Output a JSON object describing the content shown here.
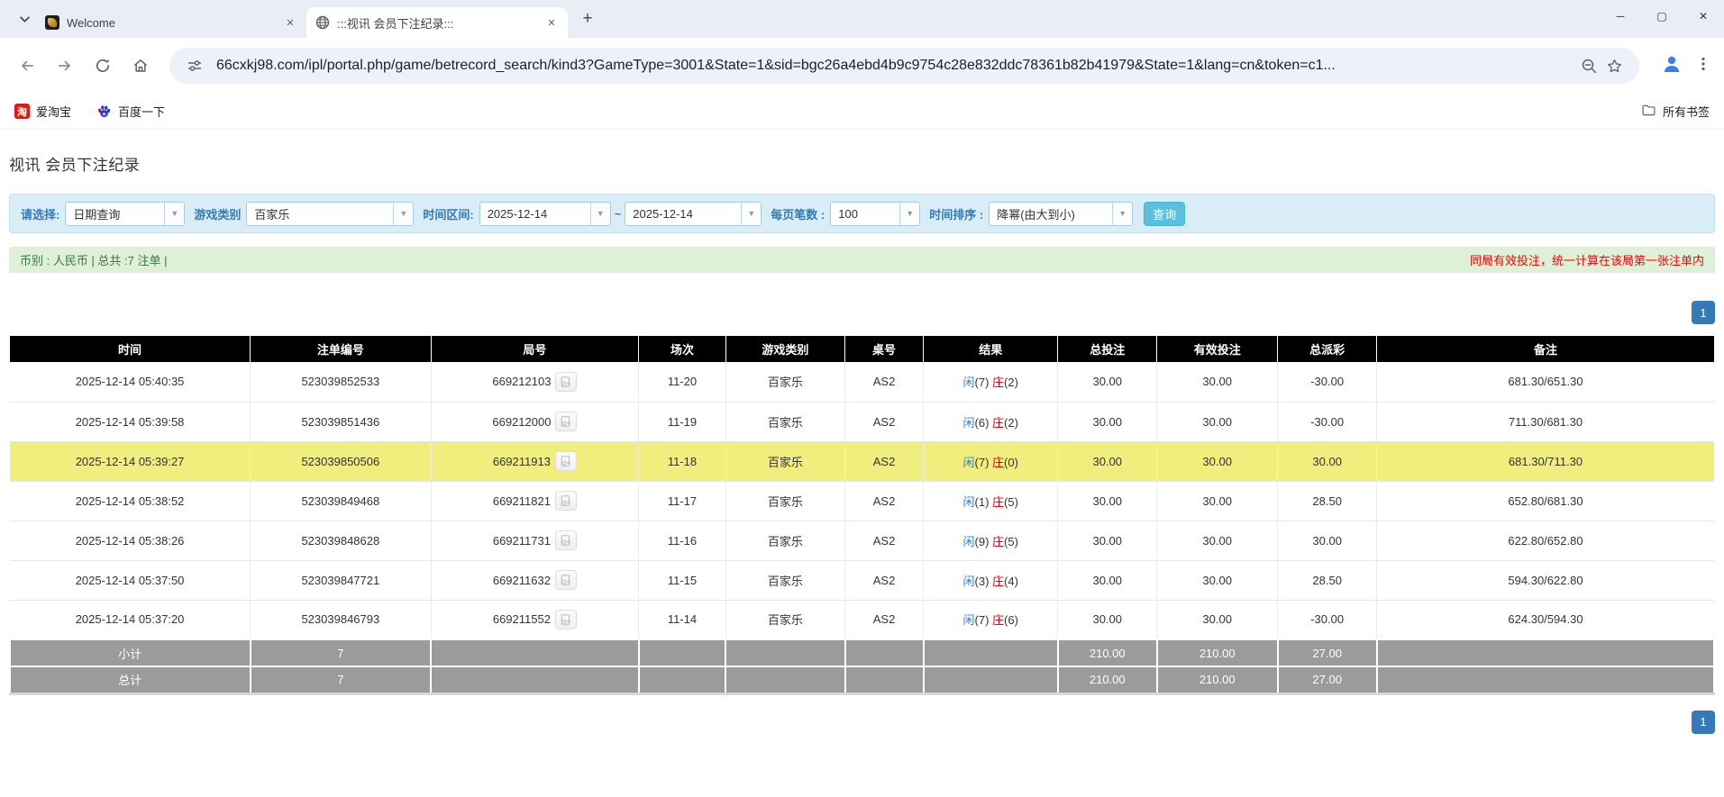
{
  "browser": {
    "tabs": [
      {
        "title": "Welcome"
      },
      {
        "title": ":::视讯 会员下注纪录:::"
      }
    ],
    "url": "66cxkj98.com/ipl/portal.php/game/betrecord_search/kind3?GameType=3001&State=1&sid=bgc26a4ebd4b9c9754c28e832ddc78361b82b41979&State=1&lang=cn&token=c1...",
    "bookmarks": [
      {
        "label": "爱淘宝",
        "icon": "taobao-icon",
        "icon_glyph": "淘"
      },
      {
        "label": "百度一下",
        "icon": "baidu-paw-icon"
      }
    ],
    "all_bookmarks_label": "所有书签",
    "window_controls": {
      "minimize": "─",
      "maximize": "▢",
      "close": "✕"
    },
    "new_tab_glyph": "+",
    "close_tab_glyph": "✕"
  },
  "page": {
    "title": "视讯 会员下注纪录",
    "filters": {
      "select_label": "请选择:",
      "select_value": "日期查询",
      "game_type_label": "游戏类别",
      "game_type_value": "百家乐",
      "time_range_label": "时间区间:",
      "date_from": "2025-12-14",
      "tilde": "~",
      "date_to": "2025-12-14",
      "per_page_label": "每页笔数 :",
      "per_page_value": "100",
      "sort_label": "时间排序 :",
      "sort_value": "降幂(由大到小)",
      "search_button": "查询"
    },
    "info_bar": {
      "left": "币别 : 人民币 | 总共 :7 注单 |",
      "right": "同局有效投注，统一计算在该局第一张注单内"
    },
    "pagination": "1",
    "colors": {
      "highlight_row": "#f0ee7d",
      "header_bg": "#000000",
      "footer_bg": "#9b9b9b",
      "link_blue": "#2e7fd0",
      "negative_red": "#ff0000",
      "filter_bg": "#d9edf7",
      "info_bg": "#dff0d8",
      "pager_blue": "#337ab7",
      "button_blue": "#5bc0de"
    },
    "table": {
      "headers": [
        "时间",
        "注单编号",
        "局号",
        "场次",
        "游戏类别",
        "桌号",
        "结果",
        "总投注",
        "有效投注",
        "总派彩",
        "备注"
      ],
      "rows": [
        {
          "time": "2025-12-14 05:40:35",
          "bet_no": "523039852533",
          "round_no": "669212103",
          "session": "11-20",
          "game": "百家乐",
          "table_no": "AS2",
          "result_player": "闲",
          "result_player_num": "(7)",
          "result_banker": "庄",
          "result_banker_num": "(2)",
          "total_bet": "30.00",
          "valid_bet": "30.00",
          "payout": "-30.00",
          "note": "681.30/651.30",
          "highlight": false
        },
        {
          "time": "2025-12-14 05:39:58",
          "bet_no": "523039851436",
          "round_no": "669212000",
          "session": "11-19",
          "game": "百家乐",
          "table_no": "AS2",
          "result_player": "闲",
          "result_player_num": "(6)",
          "result_banker": "庄",
          "result_banker_num": "(2)",
          "total_bet": "30.00",
          "valid_bet": "30.00",
          "payout": "-30.00",
          "note": "711.30/681.30",
          "highlight": false
        },
        {
          "time": "2025-12-14 05:39:27",
          "bet_no": "523039850506",
          "round_no": "669211913",
          "session": "11-18",
          "game": "百家乐",
          "table_no": "AS2",
          "result_player": "闲",
          "result_player_num": "(7)",
          "result_banker": "庄",
          "result_banker_num": "(0)",
          "total_bet": "30.00",
          "valid_bet": "30.00",
          "payout": "30.00",
          "note": "681.30/711.30",
          "highlight": true
        },
        {
          "time": "2025-12-14 05:38:52",
          "bet_no": "523039849468",
          "round_no": "669211821",
          "session": "11-17",
          "game": "百家乐",
          "table_no": "AS2",
          "result_player": "闲",
          "result_player_num": "(1)",
          "result_banker": "庄",
          "result_banker_num": "(5)",
          "total_bet": "30.00",
          "valid_bet": "30.00",
          "payout": "28.50",
          "note": "652.80/681.30",
          "highlight": false
        },
        {
          "time": "2025-12-14 05:38:26",
          "bet_no": "523039848628",
          "round_no": "669211731",
          "session": "11-16",
          "game": "百家乐",
          "table_no": "AS2",
          "result_player": "闲",
          "result_player_num": "(9)",
          "result_banker": "庄",
          "result_banker_num": "(5)",
          "total_bet": "30.00",
          "valid_bet": "30.00",
          "payout": "30.00",
          "note": "622.80/652.80",
          "highlight": false
        },
        {
          "time": "2025-12-14 05:37:50",
          "bet_no": "523039847721",
          "round_no": "669211632",
          "session": "11-15",
          "game": "百家乐",
          "table_no": "AS2",
          "result_player": "闲",
          "result_player_num": "(3)",
          "result_banker": "庄",
          "result_banker_num": "(4)",
          "total_bet": "30.00",
          "valid_bet": "30.00",
          "payout": "28.50",
          "note": "594.30/622.80",
          "highlight": false
        },
        {
          "time": "2025-12-14 05:37:20",
          "bet_no": "523039846793",
          "round_no": "669211552",
          "session": "11-14",
          "game": "百家乐",
          "table_no": "AS2",
          "result_player": "闲",
          "result_player_num": "(7)",
          "result_banker": "庄",
          "result_banker_num": "(6)",
          "total_bet": "30.00",
          "valid_bet": "30.00",
          "payout": "-30.00",
          "note": "624.30/594.30",
          "highlight": false
        }
      ],
      "footer": [
        {
          "label": "小计",
          "count": "7",
          "total_bet": "210.00",
          "valid_bet": "210.00",
          "payout": "27.00"
        },
        {
          "label": "总计",
          "count": "7",
          "total_bet": "210.00",
          "valid_bet": "210.00",
          "payout": "27.00"
        }
      ]
    }
  }
}
